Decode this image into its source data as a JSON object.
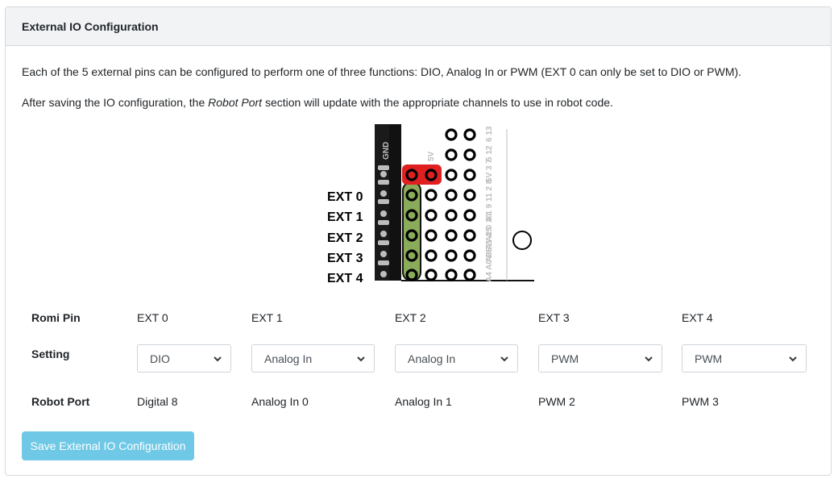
{
  "header": {
    "title": "External IO Configuration"
  },
  "intro": {
    "line1": "Each of the 5 external pins can be configured to perform one of three functions: DIO, Analog In or PWM (EXT 0 can only be set to DIO or PWM).",
    "line2_before": "After saving the IO configuration, the ",
    "line2_em": "Robot Port",
    "line2_after": " section will update with the appropriate channels to use in robot code."
  },
  "diagram": {
    "ext_labels": [
      "EXT 0",
      "EXT 1",
      "EXT 2",
      "EXT 3",
      "EXT 4"
    ],
    "gnd_label": "GND",
    "fivev_label": "5V",
    "right_labels": [
      "6  13",
      "5  12",
      "5V  3  7",
      "11  2  8",
      "4  1  9",
      "A2  0  10",
      "A3  A1  A5",
      "A4  A0  PE2"
    ],
    "colors": {
      "highlight_red": "#e02020",
      "highlight_green": "#8aab5a"
    }
  },
  "table": {
    "row_labels": {
      "pin": "Romi Pin",
      "setting": "Setting",
      "port": "Robot Port"
    },
    "columns": [
      {
        "pin": "EXT 0",
        "setting": "DIO",
        "port": "Digital 8"
      },
      {
        "pin": "EXT 1",
        "setting": "Analog In",
        "port": "Analog In 0"
      },
      {
        "pin": "EXT 2",
        "setting": "Analog In",
        "port": "Analog In 1"
      },
      {
        "pin": "EXT 3",
        "setting": "PWM",
        "port": "PWM 2"
      },
      {
        "pin": "EXT 4",
        "setting": "PWM",
        "port": "PWM 3"
      }
    ]
  },
  "save_button": {
    "label": "Save External IO Configuration",
    "color": "#6fc8e6"
  },
  "icons": {
    "select_arrow": "chevron-down-icon"
  }
}
